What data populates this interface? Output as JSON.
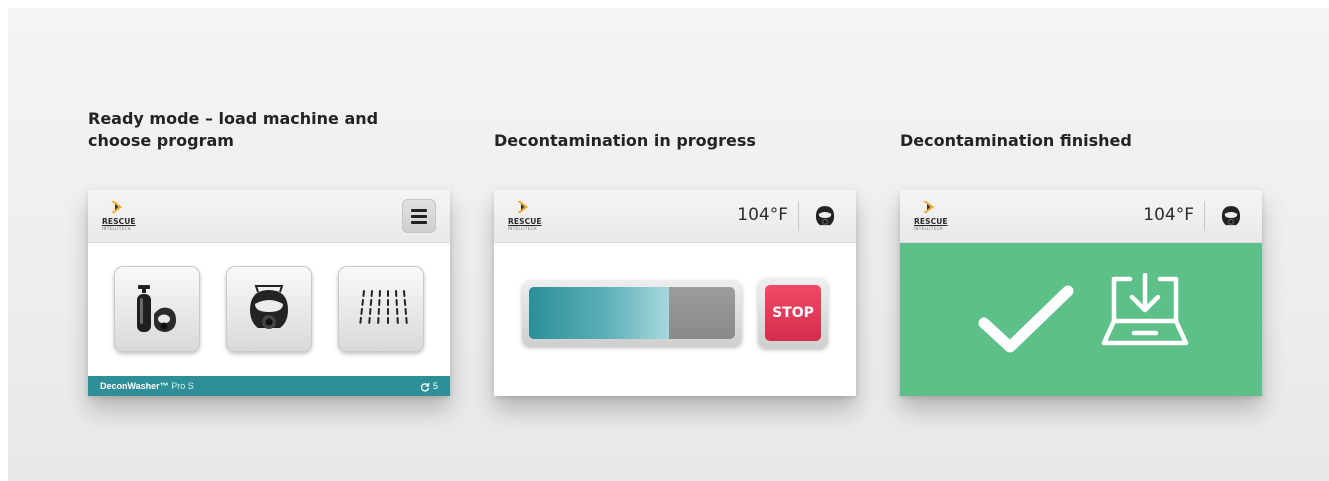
{
  "captions": {
    "ready": "Ready mode – load machine and choose program",
    "progress": "Decontamination in progress",
    "finished": "Decontamination finished"
  },
  "brand": {
    "name": "RESCUE",
    "sub": "INTELLITECH",
    "accent": "#f2a51a"
  },
  "screen_ready": {
    "menu_icon": "hamburger-menu-icon",
    "programs": [
      {
        "icon": "air-cylinder-mask-icon"
      },
      {
        "icon": "face-mask-icon"
      },
      {
        "icon": "shower-icon"
      }
    ],
    "footer": {
      "product": "DeconWasher™",
      "model": " Pro S",
      "cycles": "5",
      "cycle_icon": "refresh-icon"
    },
    "footer_color": "#2e8f99"
  },
  "screen_progress": {
    "temperature": "104°F",
    "status_icon": "face-mask-icon",
    "progress": 0.68,
    "stop_label": "STOP",
    "stop_color": "#e43a58"
  },
  "screen_finished": {
    "temperature": "104°F",
    "status_icon": "face-mask-icon",
    "done_icons": [
      "checkmark-icon",
      "unload-tray-icon"
    ],
    "panel_color": "#5ec089"
  }
}
